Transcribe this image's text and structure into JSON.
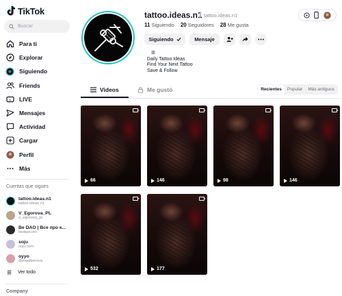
{
  "app": {
    "logo_text": "TikTok"
  },
  "search": {
    "placeholder": "Buscar"
  },
  "nav": [
    {
      "label": "Para ti",
      "icon": "home-icon"
    },
    {
      "label": "Explorar",
      "icon": "compass-icon"
    },
    {
      "label": "Siguiendo",
      "icon": "following-icon"
    },
    {
      "label": "Friends",
      "icon": "friends-icon"
    },
    {
      "label": "LIVE",
      "icon": "live-icon"
    },
    {
      "label": "Mensajes",
      "icon": "messages-icon"
    },
    {
      "label": "Actividad",
      "icon": "activity-icon"
    },
    {
      "label": "Cargar",
      "icon": "upload-icon"
    },
    {
      "label": "Perfil",
      "icon": "avatar-icon"
    },
    {
      "label": "Más",
      "icon": "more-icon"
    }
  ],
  "following_section": {
    "title": "Cuentas que sigues",
    "accounts": [
      {
        "name": "tattoo.ideas.n1",
        "handle": "tattoo.ideas.n1",
        "color": "#111111"
      },
      {
        "name": "V_Egorova_PL",
        "handle": "v_egorova_pl",
        "color": "#b9a58e"
      },
      {
        "name": "Be DAO | Все про к...",
        "handle": "bedaocom",
        "color": "#2b2b2b"
      },
      {
        "name": "soju",
        "handle": "soju.tom",
        "color": "#c9c0d6"
      },
      {
        "name": "оуyo",
        "handle": "danaalberova",
        "color": "#d7a2a8"
      }
    ],
    "see_all": "Ver todo"
  },
  "footer": {
    "company": "Company"
  },
  "profile": {
    "username": "tattoo.ideas.n1",
    "handle": "tattoo.ideas.n1",
    "stats": [
      {
        "value": "11",
        "label": "Siguiendo"
      },
      {
        "value": "20",
        "label": "Seguidores"
      },
      {
        "value": "28",
        "label": "Me gusta"
      }
    ],
    "follow_button": "Siguiendo",
    "message_button": "Mensaje",
    "bio": "     ꕥ\n  Daily Tattoo Ideas\n  Find Your Next Tattoo\n  Save & Follow"
  },
  "tabs": [
    {
      "label": "Videos",
      "active": true
    },
    {
      "label": "Me gustó",
      "active": false
    }
  ],
  "sort_options": [
    {
      "label": "Recientes",
      "selected": true
    },
    {
      "label": "Popular",
      "selected": false
    },
    {
      "label": "Más antiguos",
      "selected": false
    }
  ],
  "videos": [
    {
      "views": "66"
    },
    {
      "views": "146"
    },
    {
      "views": "98"
    },
    {
      "views": "146"
    },
    {
      "views": "532"
    },
    {
      "views": "177"
    }
  ],
  "colors": {
    "accent_ring": "#25c2c8",
    "text": "#161823"
  }
}
